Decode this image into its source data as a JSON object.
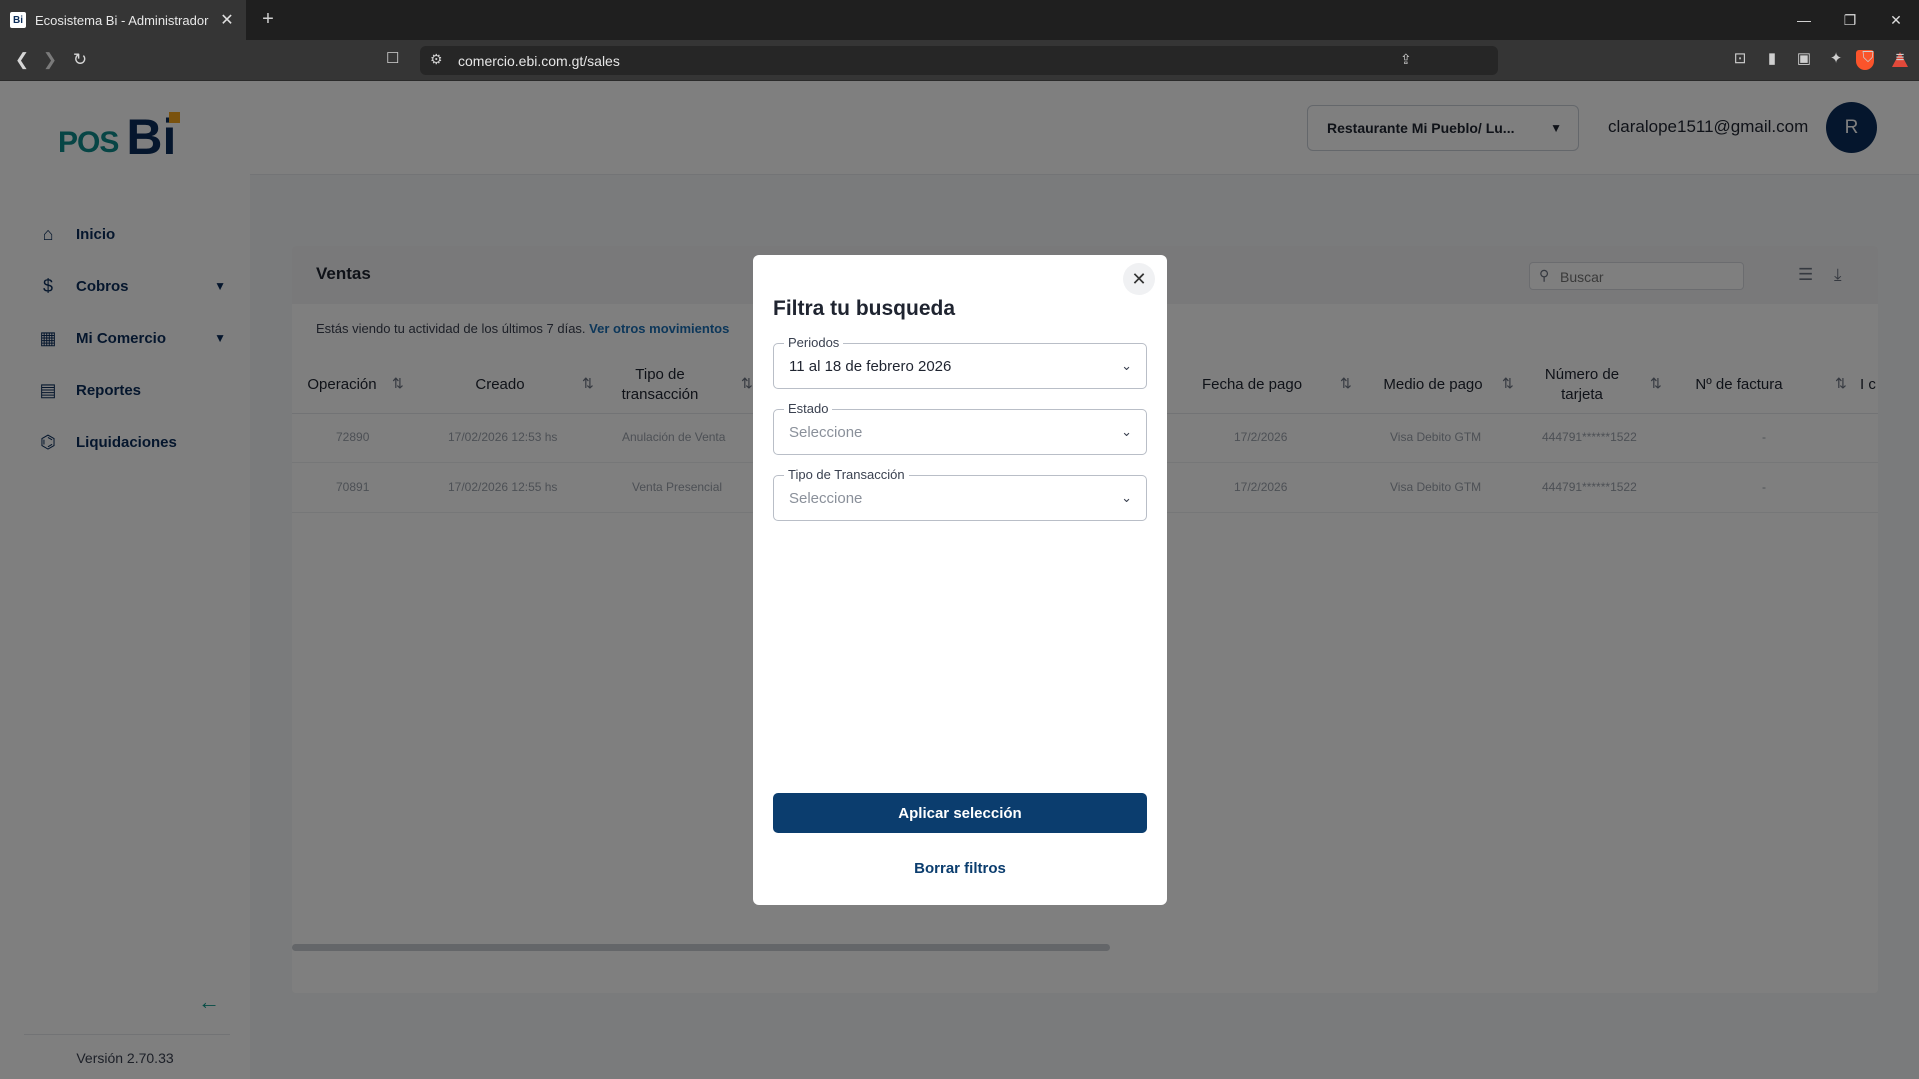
{
  "browser": {
    "tab_title": "Ecosistema Bi - Administrador",
    "favicon_text": "Bi",
    "url": "comercio.ebi.com.gt/sales"
  },
  "sidebar": {
    "logo_pos": "POS",
    "logo_bi": "Bi",
    "items": [
      {
        "label": "Inicio",
        "icon": "home-icon",
        "has_chevron": false
      },
      {
        "label": "Cobros",
        "icon": "coin-icon",
        "has_chevron": true
      },
      {
        "label": "Mi Comercio",
        "icon": "store-icon",
        "has_chevron": true
      },
      {
        "label": "Reportes",
        "icon": "report-icon",
        "has_chevron": false
      },
      {
        "label": "Liquidaciones",
        "icon": "bank-icon",
        "has_chevron": false
      }
    ],
    "version": "Versión 2.70.33"
  },
  "header": {
    "store": "Restaurante Mi Pueblo/ Lu...",
    "email": "claralope1511@gmail.com",
    "avatar_initial": "R"
  },
  "sales": {
    "title": "Ventas",
    "search_placeholder": "Buscar",
    "info_text": "Estás viendo tu actividad de los últimos 7 días.",
    "info_link": "Ver otros movimientos",
    "columns": [
      "Operación",
      "Creado",
      "Tipo de transacción",
      "Fecha de pago",
      "Medio de pago",
      "Número de tarjeta",
      "Nº de factura",
      "I c"
    ],
    "rows": [
      {
        "operacion": "72890",
        "creado": "17/02/2026 12:53 hs",
        "tipo": "Anulación de Venta",
        "fecha_pago": "17/2/2026",
        "medio": "Visa Debito GTM",
        "tarjeta": "444791******1522",
        "factura": "-"
      },
      {
        "operacion": "70891",
        "creado": "17/02/2026 12:55 hs",
        "tipo": "Venta Presencial",
        "fecha_pago": "17/2/2026",
        "medio": "Visa Debito GTM",
        "tarjeta": "444791******1522",
        "factura": "-"
      }
    ]
  },
  "modal": {
    "title": "Filtra tu busqueda",
    "fields": [
      {
        "label": "Periodos",
        "value": "11 al 18 de febrero 2026",
        "placeholder": false
      },
      {
        "label": "Estado",
        "value": "Seleccione",
        "placeholder": true
      },
      {
        "label": "Tipo de Transacción",
        "value": "Seleccione",
        "placeholder": true
      }
    ],
    "apply_label": "Aplicar selección",
    "clear_label": "Borrar filtros"
  },
  "colors": {
    "brand_navy": "#0b2d5a",
    "brand_teal": "#0e8a8a",
    "brand_orange": "#f4a51c",
    "button_primary": "#0b3d6e"
  }
}
